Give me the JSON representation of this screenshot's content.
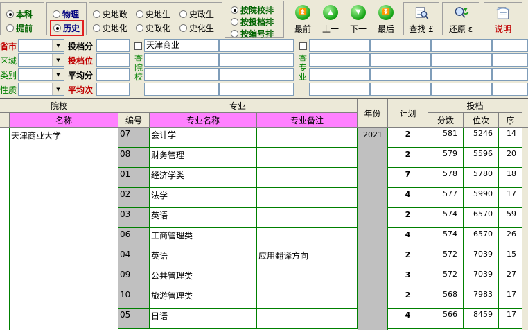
{
  "toolbar": {
    "level_options": [
      {
        "label": "本科",
        "selected": true
      },
      {
        "label": "提前",
        "selected": false
      }
    ],
    "subject_options": [
      {
        "label": "物理",
        "selected": false
      },
      {
        "label": "历史",
        "selected": true
      }
    ],
    "combo_options": [
      {
        "label": "史地政",
        "selected": false
      },
      {
        "label": "史地生",
        "selected": false
      },
      {
        "label": "史政生",
        "selected": false
      },
      {
        "label": "史地化",
        "selected": false
      },
      {
        "label": "史政化",
        "selected": false
      },
      {
        "label": "史化生",
        "selected": false
      }
    ],
    "sort_options": [
      {
        "label": "按院校排",
        "selected": true
      },
      {
        "label": "按投档排",
        "selected": false
      },
      {
        "label": "按编号排",
        "selected": false
      }
    ],
    "nav_buttons": [
      {
        "label": "最前",
        "icon": "double-up-arrow-icon",
        "glyph": "⏫"
      },
      {
        "label": "上一",
        "icon": "up-arrow-icon",
        "glyph": "▲"
      },
      {
        "label": "下一",
        "icon": "down-arrow-icon",
        "glyph": "▼"
      },
      {
        "label": "最后",
        "icon": "double-down-arrow-icon",
        "glyph": "⏬"
      }
    ],
    "find_label": "查找 £",
    "restore_label": "还原 ε",
    "help_label": "说明"
  },
  "filters": {
    "labels": {
      "province": "省市",
      "region": "区域",
      "category": "类别",
      "nature": "性质"
    },
    "score_labels": {
      "tou_fen": "投档分",
      "tou_wei": "投档位",
      "avg_fen": "平均分",
      "avg_ci": "平均次"
    },
    "school_query_label": "查院校",
    "school_query_value": "天津商业",
    "major_query_label": "查专业",
    "major_query_value": ""
  },
  "table": {
    "headers": {
      "school_group": "院校",
      "school_name": "名称",
      "major_group": "专业",
      "code": "编号",
      "major_name": "专业名称",
      "major_note": "专业备注",
      "year": "年份",
      "plan": "计划",
      "tou_group": "投档",
      "score": "分数",
      "rank": "位次",
      "seq": "序"
    },
    "school": "天津商业大学",
    "year": "2021",
    "rows": [
      {
        "code": "07",
        "name": "会计学",
        "note": "",
        "plan": "2",
        "score": "581",
        "rank": "5246",
        "seq": "14"
      },
      {
        "code": "08",
        "name": "财务管理",
        "note": "",
        "plan": "2",
        "score": "579",
        "rank": "5596",
        "seq": "20"
      },
      {
        "code": "01",
        "name": "经济学类",
        "note": "",
        "plan": "7",
        "score": "578",
        "rank": "5780",
        "seq": "18"
      },
      {
        "code": "02",
        "name": "法学",
        "note": "",
        "plan": "4",
        "score": "577",
        "rank": "5990",
        "seq": "17"
      },
      {
        "code": "03",
        "name": "英语",
        "note": "",
        "plan": "2",
        "score": "574",
        "rank": "6570",
        "seq": "59"
      },
      {
        "code": "06",
        "name": "工商管理类",
        "note": "",
        "plan": "4",
        "score": "574",
        "rank": "6570",
        "seq": "26"
      },
      {
        "code": "04",
        "name": "英语",
        "note": "应用翻译方向",
        "plan": "2",
        "score": "572",
        "rank": "7039",
        "seq": "15"
      },
      {
        "code": "09",
        "name": "公共管理类",
        "note": "",
        "plan": "3",
        "score": "572",
        "rank": "7039",
        "seq": "27"
      },
      {
        "code": "10",
        "name": "旅游管理类",
        "note": "",
        "plan": "2",
        "score": "568",
        "rank": "7983",
        "seq": "17"
      },
      {
        "code": "05",
        "name": "日语",
        "note": "",
        "plan": "4",
        "score": "566",
        "rank": "8459",
        "seq": "17"
      }
    ]
  },
  "colors": {
    "header_pink": "#ff80ff",
    "grid_green": "#008000",
    "label_red": "#c00000",
    "highlight_red": "#e02020"
  }
}
